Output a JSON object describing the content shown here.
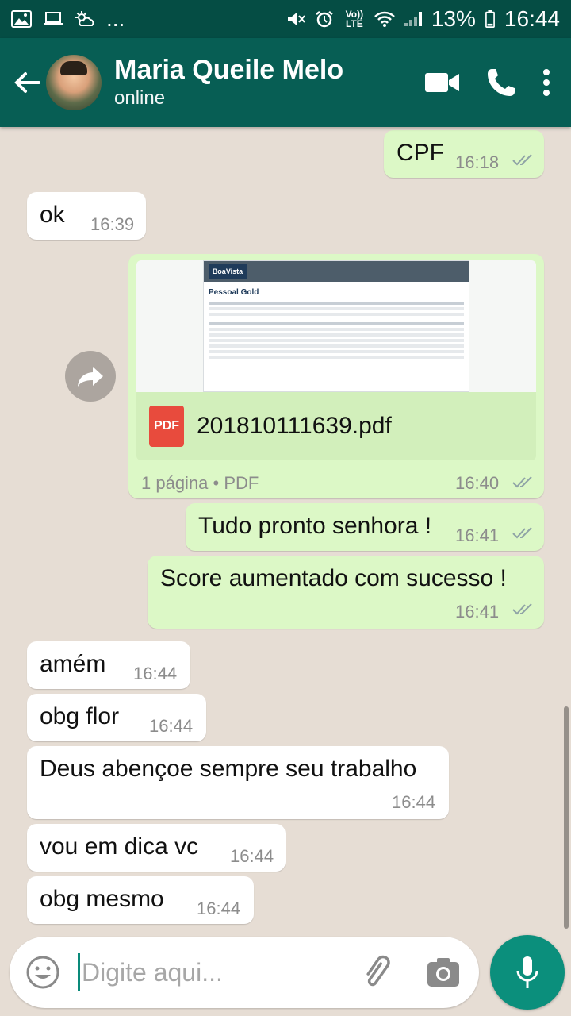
{
  "status_bar": {
    "notif_icons": [
      "image-icon",
      "laptop-icon",
      "weather-icon"
    ],
    "more": "...",
    "volte": "Vo)) LTE",
    "battery": "13%",
    "time": "16:44"
  },
  "header": {
    "name": "Maria Queile Melo",
    "status": "online"
  },
  "messages": [
    {
      "id": "m1",
      "dir": "out",
      "text": "CPF",
      "time": "16:18"
    },
    {
      "id": "m2",
      "dir": "in",
      "text": "ok",
      "time": "16:39"
    },
    {
      "id": "m3",
      "dir": "out",
      "type": "document",
      "filename": "201810111639.pdf",
      "pages": "1 página",
      "filetype": "PDF",
      "badge": "PDF",
      "time": "16:40",
      "preview": {
        "brand": "BoaVista",
        "title": "Pessoal Gold"
      }
    },
    {
      "id": "m4",
      "dir": "out",
      "text": "Tudo pronto senhora !",
      "time": "16:41"
    },
    {
      "id": "m5",
      "dir": "out",
      "text": "Score aumentado com sucesso !",
      "time": "16:41"
    },
    {
      "id": "m6",
      "dir": "in",
      "text": "amém",
      "time": "16:44"
    },
    {
      "id": "m7",
      "dir": "in",
      "text": "obg flor",
      "time": "16:44"
    },
    {
      "id": "m8",
      "dir": "in",
      "text": "Deus abençoe sempre seu trabalho",
      "time": "16:44"
    },
    {
      "id": "m9",
      "dir": "in",
      "text": "vou em dica vc",
      "time": "16:44"
    },
    {
      "id": "m10",
      "dir": "in",
      "text": "obg mesmo",
      "time": "16:44"
    }
  ],
  "input": {
    "placeholder": "Digite aqui..."
  },
  "colors": {
    "header": "#075e54",
    "status_bar": "#054d44",
    "outgoing_bubble": "#dcf8c6",
    "incoming_bubble": "#ffffff",
    "fab": "#0b8f7c"
  }
}
